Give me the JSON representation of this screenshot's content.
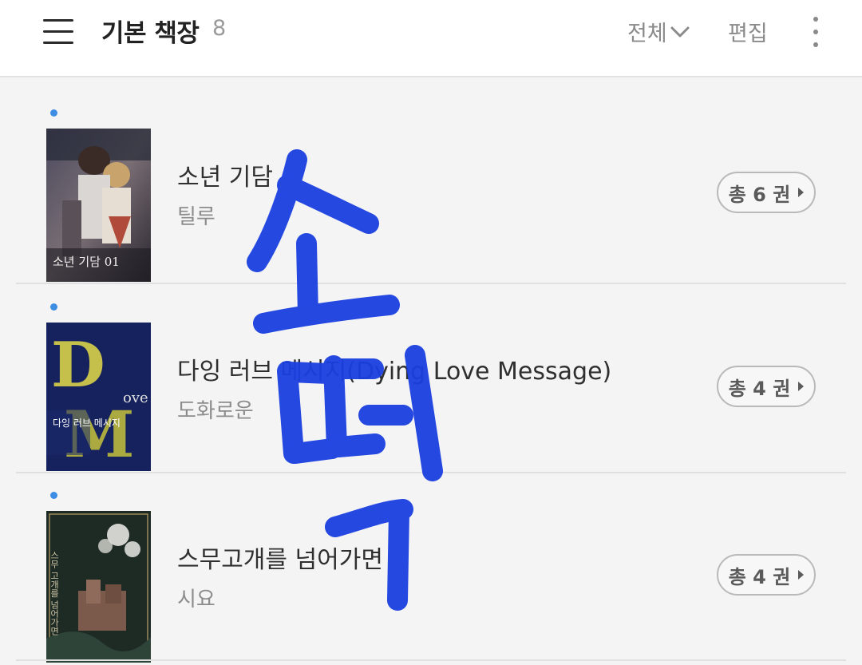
{
  "header": {
    "title": "기본 책장",
    "count": "8",
    "filter_label": "전체",
    "edit_label": "편집"
  },
  "books": [
    {
      "title": "소년 기담",
      "author": "틸루",
      "volumes_label": "총 6 권",
      "new": true,
      "cover_text": "소년 기담 01"
    },
    {
      "title": "다잉 러브 메시지(Dying Love Message)",
      "author": "도화로운",
      "volumes_label": "총 4 권",
      "new": true,
      "cover_text": "다잉 러브 메시지"
    },
    {
      "title": "스무고개를 넘어가면",
      "author": "시요",
      "volumes_label": "총 4 권",
      "new": true,
      "cover_text": "스무 고개를 넘어가면"
    }
  ],
  "overlay": {
    "handwriting": "소떡",
    "color": "#1a3fe0"
  },
  "colors": {
    "new_dot": "#3d8de4",
    "background": "#f4f4f4",
    "header_bg": "#ffffff"
  }
}
